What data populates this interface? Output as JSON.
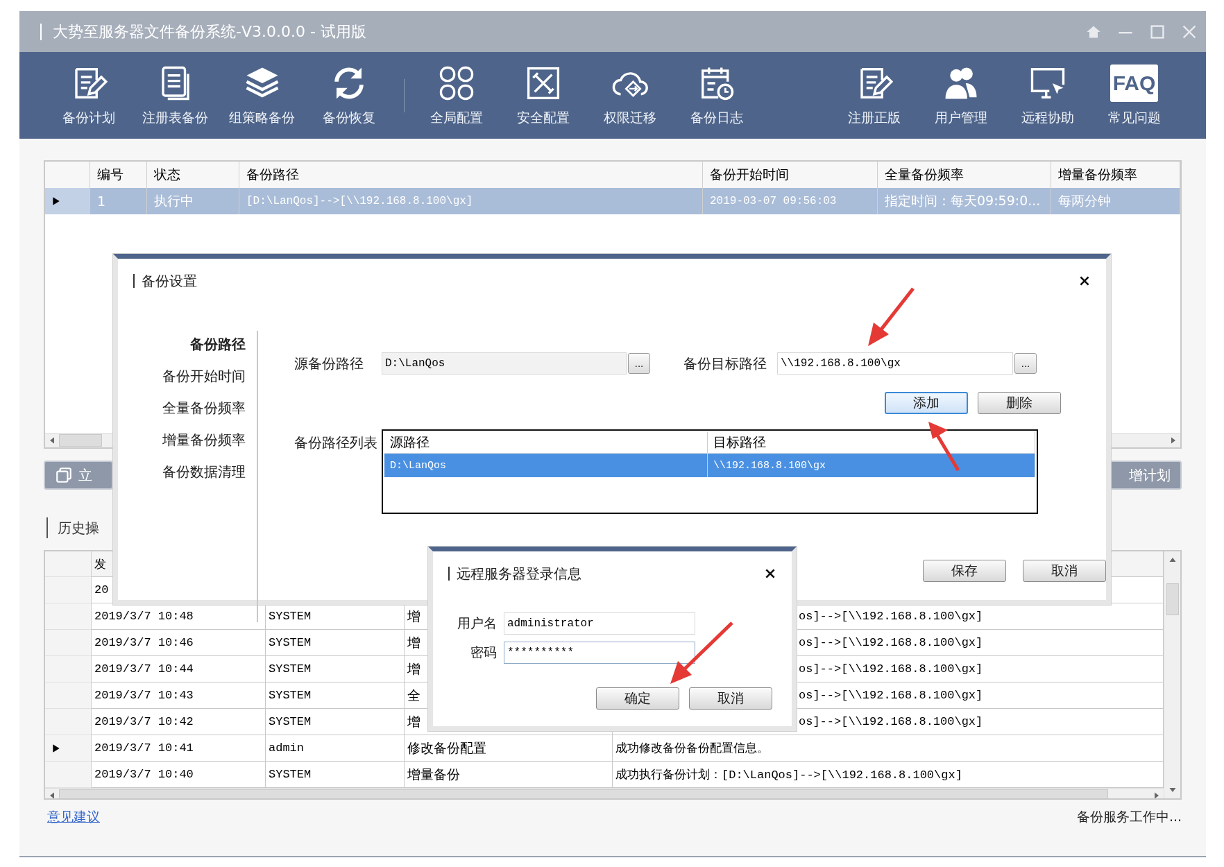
{
  "window": {
    "title": "大势至服务器文件备份系统-V3.0.0.0 - 试用版"
  },
  "toolbar": {
    "groups": [
      {
        "items": [
          {
            "label": "备份计划"
          },
          {
            "label": "注册表备份"
          },
          {
            "label": "组策略备份"
          },
          {
            "label": "备份恢复"
          }
        ]
      },
      {
        "items": [
          {
            "label": "全局配置"
          },
          {
            "label": "安全配置"
          },
          {
            "label": "权限迁移"
          },
          {
            "label": "备份日志"
          }
        ]
      },
      {
        "items": [
          {
            "label": "注册正版"
          },
          {
            "label": "用户管理"
          },
          {
            "label": "远程协助"
          },
          {
            "label": "常见问题",
            "icon_text": "FAQ"
          }
        ]
      }
    ]
  },
  "plans_table": {
    "columns": [
      "编号",
      "状态",
      "备份路径",
      "备份开始时间",
      "全量备份频率",
      "增量备份频率"
    ],
    "rows": [
      {
        "selected": true,
        "cells": [
          "1",
          "执行中",
          "[D:\\LanQos]-->[\\\\192.168.8.100\\gx]",
          "2019-03-07 09:56:03",
          "指定时间：每天09:59:0...",
          "每两分钟"
        ]
      }
    ]
  },
  "plan_buttons": [
    "立",
    "增计划"
  ],
  "history": {
    "title": "历史操",
    "columns": [
      "发"
    ],
    "rows": [
      {
        "time": "20",
        "current": false
      },
      {
        "time": "2019/3/7 10:48",
        "user": "SYSTEM",
        "operation": "增",
        "description": "os]-->[\\\\192.168.8.100\\gx]",
        "covered": true,
        "current": false
      },
      {
        "time": "2019/3/7 10:46",
        "user": "SYSTEM",
        "operation": "增",
        "description": "os]-->[\\\\192.168.8.100\\gx]",
        "covered": true,
        "current": false
      },
      {
        "time": "2019/3/7 10:44",
        "user": "SYSTEM",
        "operation": "增",
        "description": "os]-->[\\\\192.168.8.100\\gx]",
        "covered": true,
        "current": false
      },
      {
        "time": "2019/3/7 10:43",
        "user": "SYSTEM",
        "operation": "全",
        "description": "os]-->[\\\\192.168.8.100\\gx]",
        "covered": true,
        "current": false
      },
      {
        "time": "2019/3/7 10:42",
        "user": "SYSTEM",
        "operation": "增",
        "description": "os]-->[\\\\192.168.8.100\\gx]",
        "covered": true,
        "current": false
      },
      {
        "time": "2019/3/7 10:41",
        "user": "admin",
        "operation": "修改备份配置",
        "description": "成功修改备份备份配置信息。",
        "covered": false,
        "current": true
      },
      {
        "time": "2019/3/7 10:40",
        "user": "SYSTEM",
        "operation": "增量备份",
        "description": "成功执行备份计划：[D:\\LanQos]-->[\\\\192.168.8.100\\gx]",
        "covered": false,
        "current": false
      }
    ]
  },
  "footer": {
    "link": "意见建议",
    "status": "备份服务工作中..."
  },
  "settings_dialog": {
    "title": "备份设置",
    "nav": [
      {
        "label": "备份路径",
        "selected": true
      },
      {
        "label": "备份开始时间",
        "selected": false
      },
      {
        "label": "全量备份频率",
        "selected": false
      },
      {
        "label": "增量备份频率",
        "selected": false
      },
      {
        "label": "备份数据清理",
        "selected": false
      }
    ],
    "source_label": "源备份路径",
    "source_value": "D:\\LanQos",
    "target_label": "备份目标路径",
    "target_value": "\\\\192.168.8.100\\gx",
    "browse_button": "...",
    "add_button": {
      "label": "添加",
      "focused": true
    },
    "delete_button": {
      "label": "删除",
      "focused": false
    },
    "list_label": "备份路径列表",
    "list": {
      "columns": [
        "源路径",
        "目标路径"
      ],
      "rows": [
        {
          "selected": true,
          "cells": [
            "D:\\LanQos",
            "\\\\192.168.8.100\\gx"
          ]
        }
      ]
    },
    "save_button": "保存",
    "cancel_button": "取消"
  },
  "login_dialog": {
    "title": "远程服务器登录信息",
    "username_label": "用户名",
    "username": "administrator",
    "password_label": "密码",
    "password": "**********",
    "ok_button": "确定",
    "cancel_button": "取消"
  }
}
